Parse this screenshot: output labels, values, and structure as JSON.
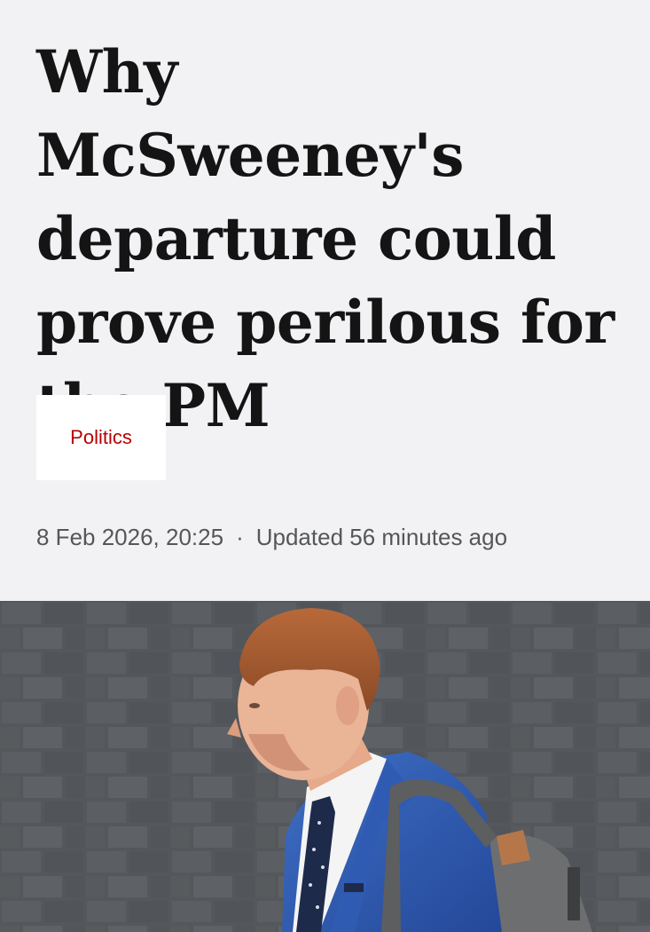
{
  "article": {
    "headline": "Why McSweeney's departure could prove perilous for the PM",
    "topic": "Politics",
    "published": "8 Feb 2026, 20:25",
    "separator": "·",
    "updated": "Updated 56 minutes ago"
  },
  "colors": {
    "background": "#f2f2f5",
    "headline": "#141414",
    "topic": "#b80000",
    "meta": "#545658"
  },
  "hero_image": {
    "description_icon": "photo-of-man-in-blue-suit-icon"
  }
}
